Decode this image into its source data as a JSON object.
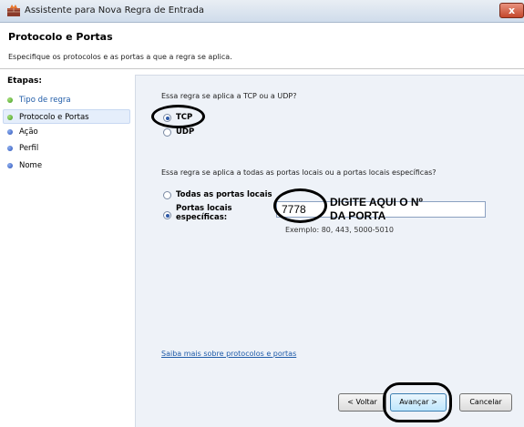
{
  "window": {
    "title": "Assistente para Nova Regra de Entrada",
    "close_label": "x"
  },
  "header": {
    "title": "Protocolo e Portas",
    "subtitle": "Especifique os protocolos e as portas a que a regra se aplica."
  },
  "sidebar": {
    "title": "Etapas:",
    "steps": [
      {
        "label": "Tipo de regra",
        "status": "done"
      },
      {
        "label": "Protocolo e Portas",
        "status": "current"
      },
      {
        "label": "Ação",
        "status": "pending"
      },
      {
        "label": "Perfil",
        "status": "pending"
      },
      {
        "label": "Nome",
        "status": "pending"
      }
    ]
  },
  "protocol": {
    "question": "Essa regra se aplica a TCP ou a UDP?",
    "options": [
      {
        "label": "TCP",
        "selected": true
      },
      {
        "label": "UDP",
        "selected": false
      }
    ]
  },
  "ports": {
    "question": "Essa regra se aplica a todas as portas locais ou a portas locais específicas?",
    "all_label": "Todas as portas locais",
    "specific_label_1": "Portas locais",
    "specific_label_2": "específicas:",
    "selected": "specific",
    "value": "7778",
    "example": "Exemplo: 80, 443, 5000-5010"
  },
  "annotation": {
    "line1": "DIGITE AQUI O Nº",
    "line2": "DA PORTA"
  },
  "link": {
    "text": "Saiba mais sobre protocolos e portas"
  },
  "buttons": {
    "back": "< Voltar",
    "next": "Avançar >",
    "cancel": "Cancelar"
  },
  "colors": {
    "accent": "#1f5ba8",
    "content_bg": "#eef2f8",
    "done_dot": "#3c9a1e",
    "pending_dot": "#2850b8"
  }
}
